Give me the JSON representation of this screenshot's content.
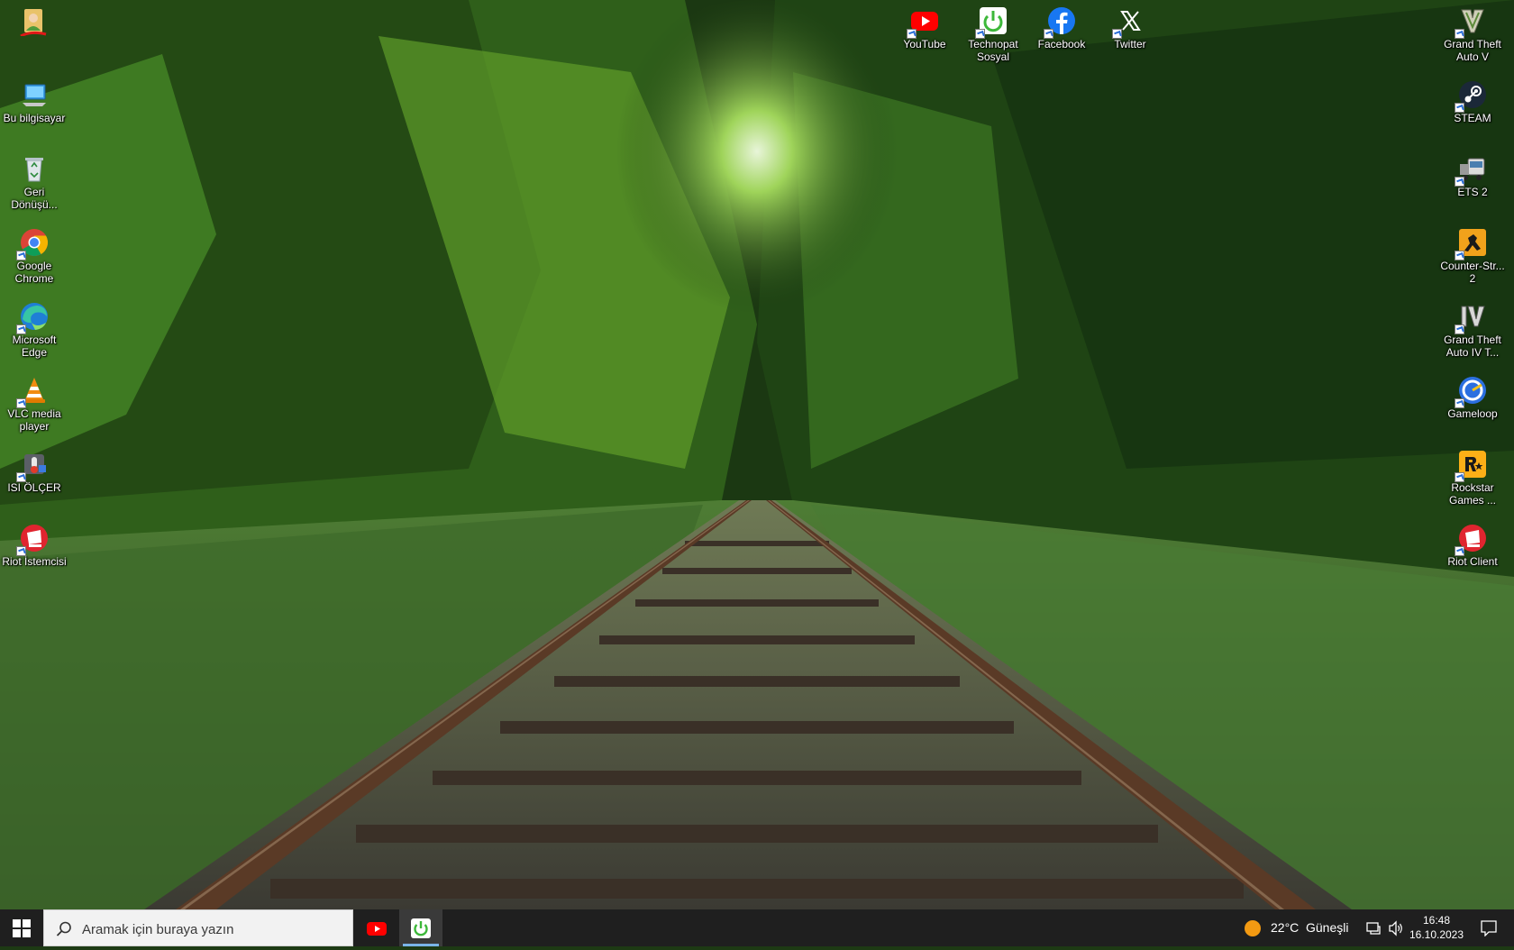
{
  "desktop": {
    "left_icons": [
      {
        "label": "",
        "icon": "user-folder-icon"
      },
      {
        "label": "Bu bilgisayar",
        "icon": "computer-icon"
      },
      {
        "label": "Geri\nDönüşü...",
        "icon": "recycle-bin-icon"
      },
      {
        "label": "Google\nChrome",
        "icon": "chrome-icon"
      },
      {
        "label": "Microsoft\nEdge",
        "icon": "edge-icon"
      },
      {
        "label": "VLC media\nplayer",
        "icon": "vlc-icon"
      },
      {
        "label": "ISI ÖLÇER",
        "icon": "thermometer-app-icon"
      },
      {
        "label": "Riot İstemcisi",
        "icon": "riot-icon"
      }
    ],
    "top_icons": [
      {
        "label": "YouTube",
        "icon": "youtube-icon"
      },
      {
        "label": "Technopat\nSosyal",
        "icon": "technopat-icon"
      },
      {
        "label": "Facebook",
        "icon": "facebook-icon"
      },
      {
        "label": "Twitter",
        "icon": "twitter-x-icon"
      }
    ],
    "right_icons": [
      {
        "label": "Grand Theft\nAuto V",
        "icon": "gta5-icon"
      },
      {
        "label": "STEAM",
        "icon": "steam-icon"
      },
      {
        "label": "ETS 2",
        "icon": "ets2-icon"
      },
      {
        "label": "Counter-Str...\n2",
        "icon": "counter-strike-icon"
      },
      {
        "label": "Grand Theft\nAuto IV T...",
        "icon": "gta4-icon"
      },
      {
        "label": "Gameloop",
        "icon": "gameloop-icon"
      },
      {
        "label": "Rockstar\nGames ...",
        "icon": "rockstar-icon"
      },
      {
        "label": "Riot Client",
        "icon": "riot-client-icon"
      }
    ]
  },
  "taskbar": {
    "search_placeholder": "Aramak için buraya yazın",
    "pinned_apps": [
      {
        "name": "YouTube",
        "icon": "youtube-icon",
        "active": false
      },
      {
        "name": "Technopat Sosyal",
        "icon": "technopat-icon",
        "active": true
      }
    ],
    "weather": {
      "temperature": "22°C",
      "condition": "Güneşli",
      "icon": "sun-icon"
    },
    "time": "16:48",
    "date": "16.10.2023"
  },
  "colors": {
    "taskbar_bg": "#1f1f1f",
    "search_bg": "#f2f2f2",
    "active_indicator": "#7ab4e8",
    "windows_logo": "#ffffff"
  }
}
